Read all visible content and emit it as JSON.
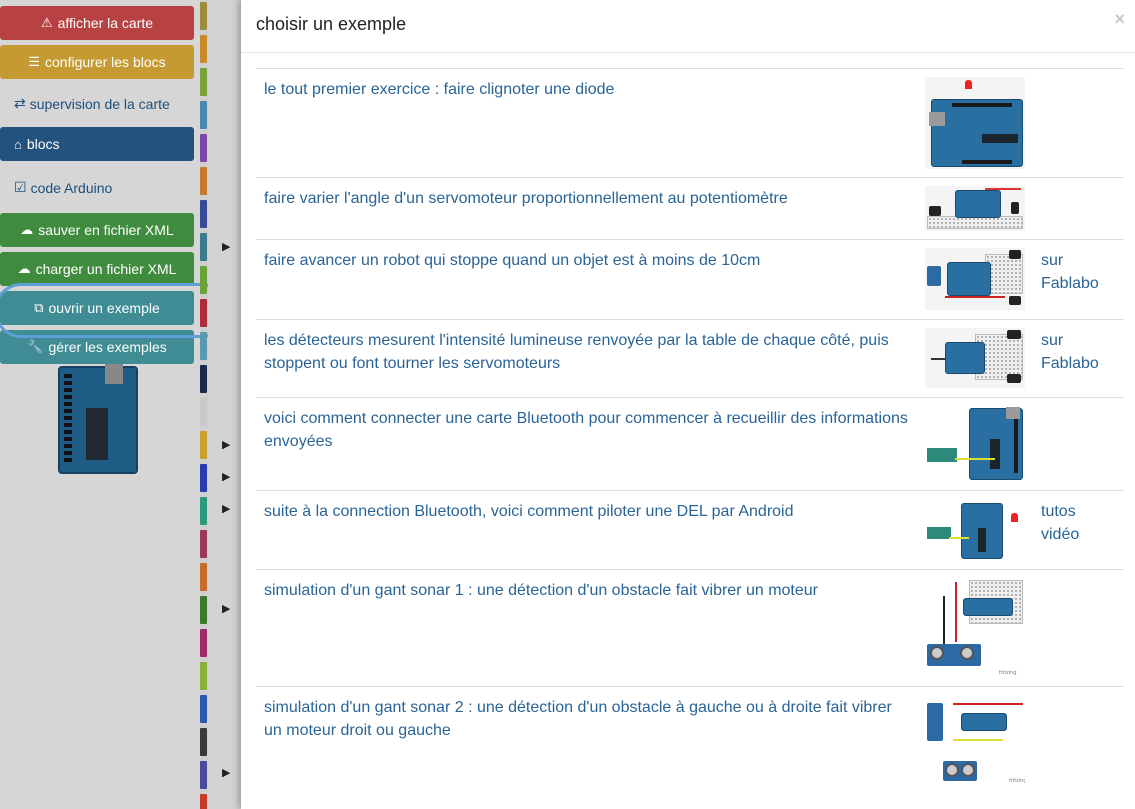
{
  "sidebar": {
    "show_board_label": "afficher la carte",
    "configure_blocks_label": "configurer les blocs",
    "board_supervision_label": "supervision de la carte",
    "blocks_label": "blocs",
    "arduino_code_label": "code Arduino",
    "save_xml_label": "sauver en fichier XML",
    "load_xml_label": "charger un fichier XML",
    "open_example_label": "ouvrir un exemple",
    "manage_examples_label": "gérer les exemples"
  },
  "modal": {
    "title": "choisir un exemple",
    "close_symbol": "×",
    "examples": [
      {
        "title": "le tout premier exercice : faire clignoter une diode",
        "extra": "",
        "thumb": "arduino-led"
      },
      {
        "title": "faire varier l'angle d'un servomoteur proportionnellement au potentiomètre",
        "extra": "",
        "thumb": "arduino-servo-pot"
      },
      {
        "title": "faire avancer un robot qui stoppe quand un objet est à moins de 10cm",
        "extra": "sur Fablabo",
        "thumb": "robot-sonar"
      },
      {
        "title": "les détecteurs mesurent l'intensité lumineuse renvoyée par la table de chaque côté, puis stoppent ou font tourner les servomoteurs",
        "extra": "sur Fablabo",
        "thumb": "robot-light"
      },
      {
        "title": "voici comment connecter une carte Bluetooth pour commencer à recueillir des informations envoyées",
        "extra": "",
        "thumb": "arduino-bluetooth"
      },
      {
        "title": "suite à la connection Bluetooth, voici comment piloter une DEL par Android",
        "extra": "tutos vidéo",
        "thumb": "bluetooth-led"
      },
      {
        "title": "simulation d'un gant sonar 1 : une détection d'un obstacle fait vibrer un moteur",
        "extra": "",
        "thumb": "sonar-glove-1"
      },
      {
        "title": "simulation d'un gant sonar 2 : une détection d'un obstacle à gauche ou à droite fait vibrer un moteur droit ou gauche",
        "extra": "",
        "thumb": "sonar-glove-2"
      }
    ],
    "fritzing_mark": "fritzing"
  },
  "colors": {
    "link": "#2a6496",
    "danger": "#b84141",
    "warning": "#c69a32",
    "primary": "#24527e",
    "success": "#3f8c3f",
    "info": "#3f8c94"
  }
}
